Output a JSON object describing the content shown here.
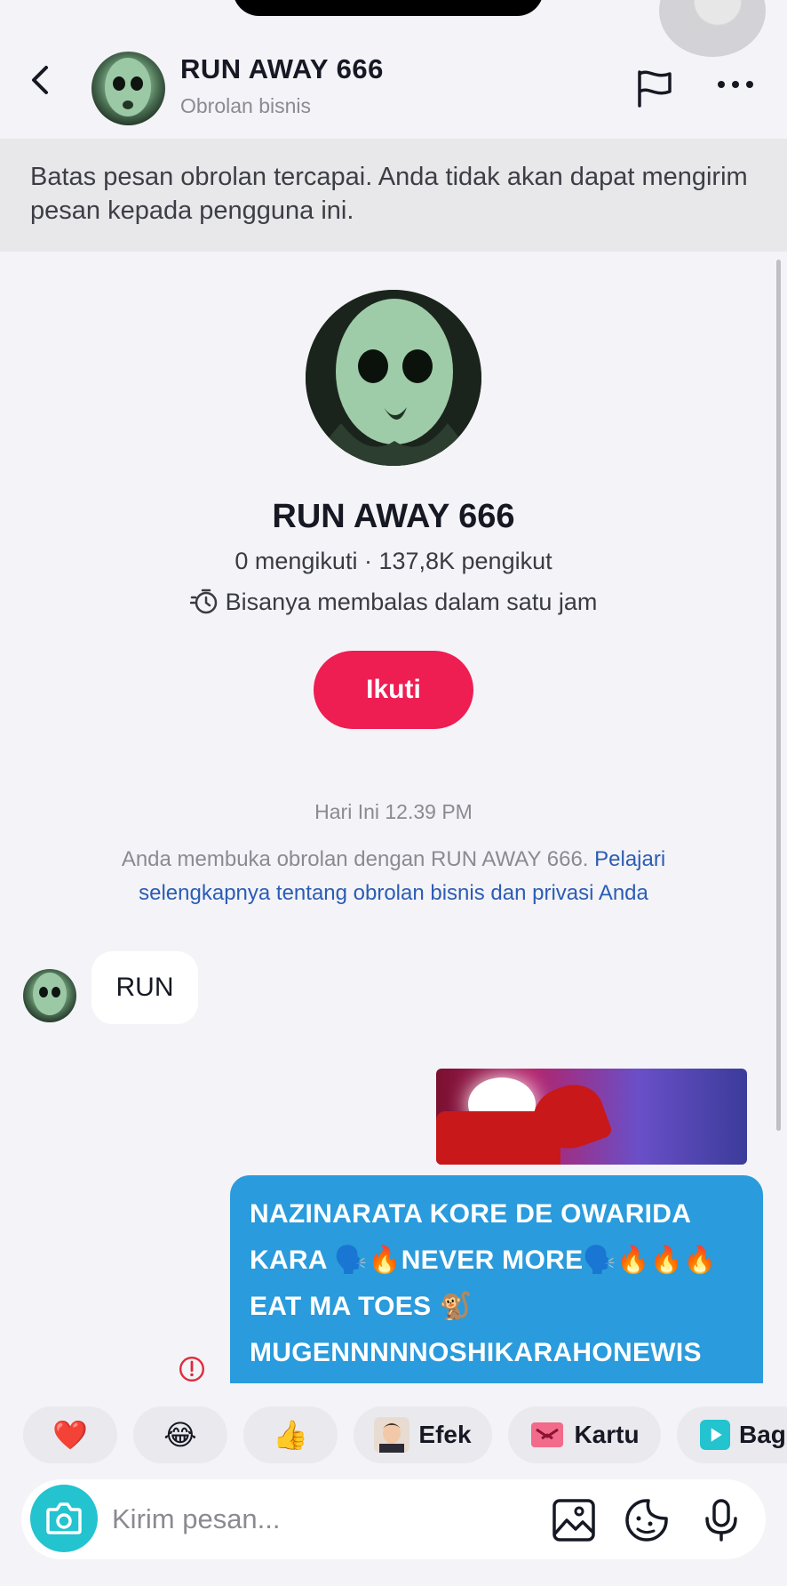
{
  "header": {
    "title": "RUN AWAY 666",
    "subtitle": "Obrolan bisnis"
  },
  "banner": {
    "text": "Batas pesan obrolan tercapai. Anda tidak akan dapat mengirim pesan kepada pengguna ini."
  },
  "profile": {
    "name": "RUN AWAY 666",
    "stats": "0 mengikuti · 137,8K pengikut",
    "reply_time": "Bisanya membalas dalam satu jam",
    "follow_label": "Ikuti"
  },
  "chat": {
    "timestamp": "Hari Ini 12.39 PM",
    "info_text": "Anda membuka obrolan dengan RUN AWAY 666.",
    "info_link": "Pelajari selengkapnya tentang obrolan bisnis dan privasi Anda",
    "messages": [
      {
        "direction": "in",
        "text": "RUN"
      },
      {
        "direction": "out",
        "type": "media"
      },
      {
        "direction": "out",
        "text": "NAZINARATA KORE DE OWARIDA KARA 🗣️🔥NEVER MORE🗣️🔥🔥🔥 EAT MA TOES 🐒 MUGENNNNNOSHIKARAHONEWIS HIKE🔥 KEEP THE FAITH 🗣️🔥🔥"
      }
    ]
  },
  "quick_replies": [
    {
      "icon": "heart",
      "emoji": "❤️",
      "label": ""
    },
    {
      "icon": "laugh",
      "emoji": "😂",
      "label": ""
    },
    {
      "icon": "thumbs-up",
      "emoji": "👍",
      "label": ""
    },
    {
      "icon": "effect",
      "label": "Efek"
    },
    {
      "icon": "card",
      "label": "Kartu"
    },
    {
      "icon": "share",
      "label": "Bag"
    }
  ],
  "composer": {
    "placeholder": "Kirim pesan..."
  }
}
